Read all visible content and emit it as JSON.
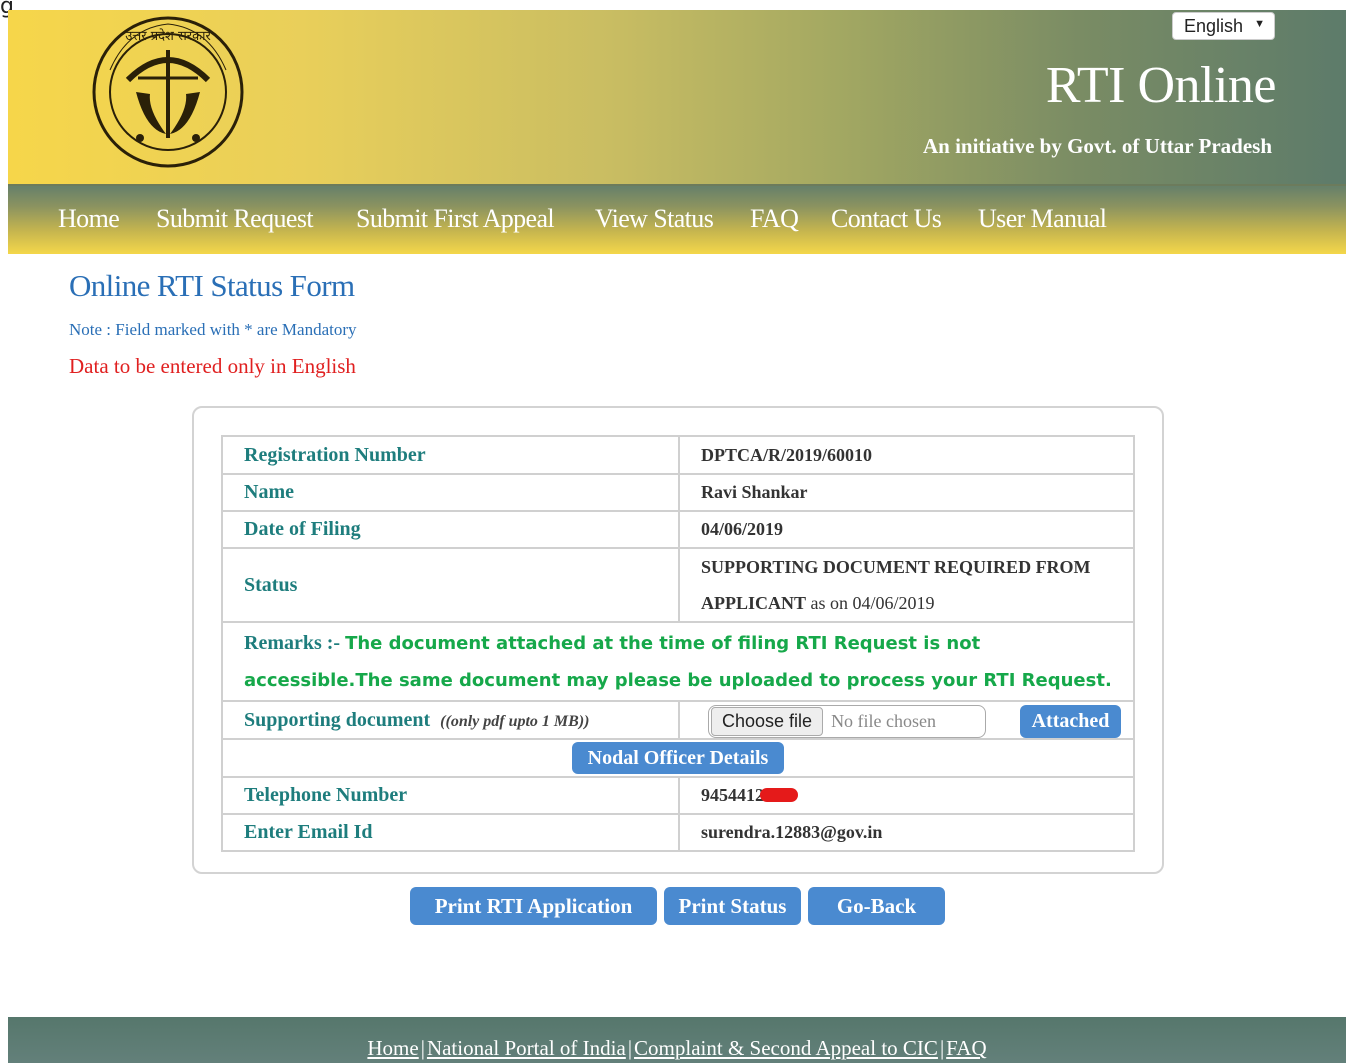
{
  "header": {
    "language": "English",
    "title": "RTI Online",
    "subtitle": "An initiative by Govt. of Uttar Pradesh",
    "emblem_text": "उत्तर प्रदेश सरकार"
  },
  "nav": {
    "items": [
      "Home",
      "Submit Request",
      "Submit First Appeal",
      "View Status",
      "FAQ",
      "Contact Us",
      "User Manual"
    ]
  },
  "page": {
    "title": "Online RTI Status Form",
    "note": "Note : Field marked with * are Mandatory",
    "english_only": "Data to be entered only in English"
  },
  "form": {
    "registration_label": "Registration Number",
    "registration_value": "DPTCA/R/2019/60010",
    "name_label": "Name",
    "name_value": "Ravi Shankar",
    "date_label": "Date of Filing",
    "date_value": "04/06/2019",
    "status_label": "Status",
    "status_line1": "SUPPORTING DOCUMENT REQUIRED FROM",
    "status_line2": "APPLICANT",
    "status_as_on": " as on 04/06/2019",
    "remarks_label": "Remarks :- ",
    "remarks_text": "The document attached at the time of filing RTI Request is not accessible.The same document may please be uploaded to process your RTI Request.",
    "supporting_label": "Supporting document",
    "supporting_hint": "((only pdf upto 1 MB))",
    "choose_file": "Choose file",
    "no_file": "No file chosen",
    "attached_button": "Attached",
    "nodal_button": "Nodal Officer Details",
    "telephone_label": "Telephone Number",
    "telephone_value": "9454412",
    "email_label": "Enter Email Id",
    "email_value": "surendra.12883@gov.in"
  },
  "actions": {
    "print_application": "Print RTI Application",
    "print_status": "Print Status",
    "go_back": "Go-Back"
  },
  "footer": {
    "links": [
      "Home",
      "National Portal of India",
      "Complaint & Second Appeal to CIC",
      "FAQ"
    ]
  },
  "colors": {
    "accent_blue": "#4a8ad0",
    "title_blue": "#2a6fb6",
    "label_teal": "#1e7d7d",
    "remarks_green": "#16a84a",
    "warning_red": "#e02020"
  }
}
